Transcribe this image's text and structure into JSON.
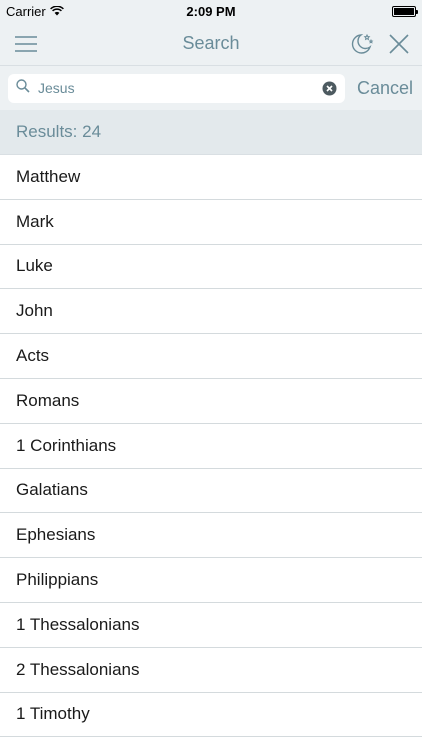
{
  "status_bar": {
    "carrier": "Carrier",
    "time": "2:09 PM"
  },
  "nav": {
    "title": "Search",
    "icons": [
      "hamburger-menu-icon",
      "night-mode-icon",
      "close-icon"
    ],
    "accent_color": "#6a8c99"
  },
  "search": {
    "value": "Jesus",
    "placeholder": "Search",
    "cancel_label": "Cancel"
  },
  "results": {
    "header": "Results: 24",
    "items": [
      "Matthew",
      "Mark",
      "Luke",
      "John",
      "Acts",
      "Romans",
      "1 Corinthians",
      "Galatians",
      "Ephesians",
      "Philippians",
      "1 Thessalonians",
      "2 Thessalonians",
      "1 Timothy"
    ]
  }
}
